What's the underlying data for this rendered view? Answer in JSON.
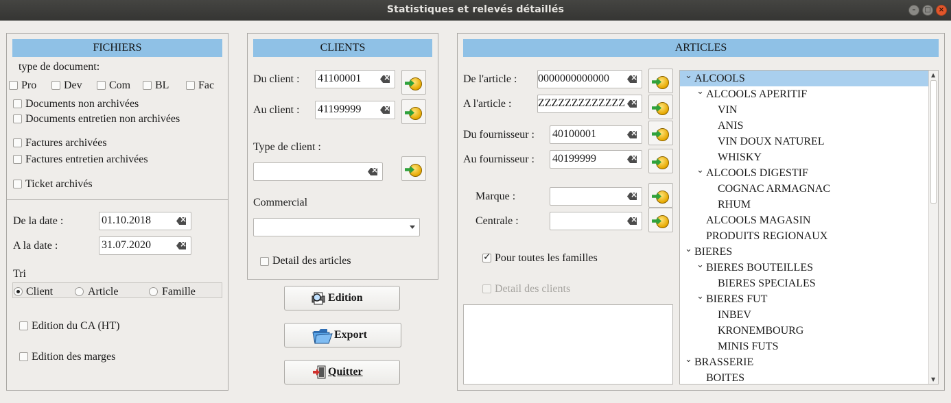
{
  "window": {
    "title": "Statistiques et relevés détaillés"
  },
  "fichiers": {
    "header": "FICHIERS",
    "type_label": "type de document:",
    "doc_types": [
      "Pro",
      "Dev",
      "Com",
      "BL",
      "Fac"
    ],
    "options": [
      "Documents non archivées",
      "Documents entretien non archivées",
      "Factures archivées",
      "Factures entretien archivées",
      "Ticket archivés"
    ],
    "date_from_label": "De la date :",
    "date_from": "01.10.2018",
    "date_to_label": "A la date :",
    "date_to": "31.07.2020",
    "tri_label": "Tri",
    "tri_options": [
      "Client",
      "Article",
      "Famille"
    ],
    "tri_selected": "Client",
    "edition_ca": "Edition du CA (HT)",
    "edition_marges": "Edition des marges"
  },
  "clients": {
    "header": "CLIENTS",
    "from_label": "Du client :",
    "from_value": "41100001",
    "to_label": "Au client :",
    "to_value": "41199999",
    "type_label": "Type de client  :",
    "type_value": "",
    "commercial_label": "Commercial",
    "commercial_value": "",
    "detail_label": "Detail des articles"
  },
  "actions": {
    "edition": "Edition",
    "export": "Export",
    "quitter": "Quitter"
  },
  "articles": {
    "header": "ARTICLES",
    "from_label": "De l'article  :",
    "from_value": "0000000000000",
    "to_label": "A l'article   :",
    "to_value": "ZZZZZZZZZZZZZ",
    "fourn_from_label": "Du fournisseur :",
    "fourn_from_value": "40100001",
    "fourn_to_label": "Au fournisseur :",
    "fourn_to_value": "40199999",
    "marque_label": "Marque :",
    "marque_value": "",
    "centrale_label": "Centrale :",
    "centrale_value": "",
    "toutes_familles_label": "Pour toutes les familles",
    "toutes_familles_checked": true,
    "detail_clients_label": "Detail des clients"
  },
  "tree": [
    {
      "label": "ALCOOLS",
      "level": 0,
      "expanded": true,
      "selected": true
    },
    {
      "label": "ALCOOLS APERITIF",
      "level": 1,
      "expanded": true
    },
    {
      "label": "VIN",
      "level": 2
    },
    {
      "label": "ANIS",
      "level": 2
    },
    {
      "label": "VIN DOUX NATUREL",
      "level": 2
    },
    {
      "label": "WHISKY",
      "level": 2
    },
    {
      "label": "ALCOOLS DIGESTIF",
      "level": 1,
      "expanded": true
    },
    {
      "label": "COGNAC ARMAGNAC",
      "level": 2
    },
    {
      "label": "RHUM",
      "level": 2
    },
    {
      "label": "ALCOOLS MAGASIN",
      "level": 1
    },
    {
      "label": "PRODUITS REGIONAUX",
      "level": 1
    },
    {
      "label": "BIERES",
      "level": 0,
      "expanded": true
    },
    {
      "label": "BIERES BOUTEILLES",
      "level": 1,
      "expanded": true
    },
    {
      "label": "BIERES SPECIALES",
      "level": 2
    },
    {
      "label": "BIERES FUT",
      "level": 1,
      "expanded": true
    },
    {
      "label": "INBEV",
      "level": 2
    },
    {
      "label": "KRONEMBOURG",
      "level": 2
    },
    {
      "label": "MINIS FUTS",
      "level": 2
    },
    {
      "label": "BRASSERIE",
      "level": 0,
      "expanded": true
    },
    {
      "label": "BOITES",
      "level": 1
    }
  ]
}
